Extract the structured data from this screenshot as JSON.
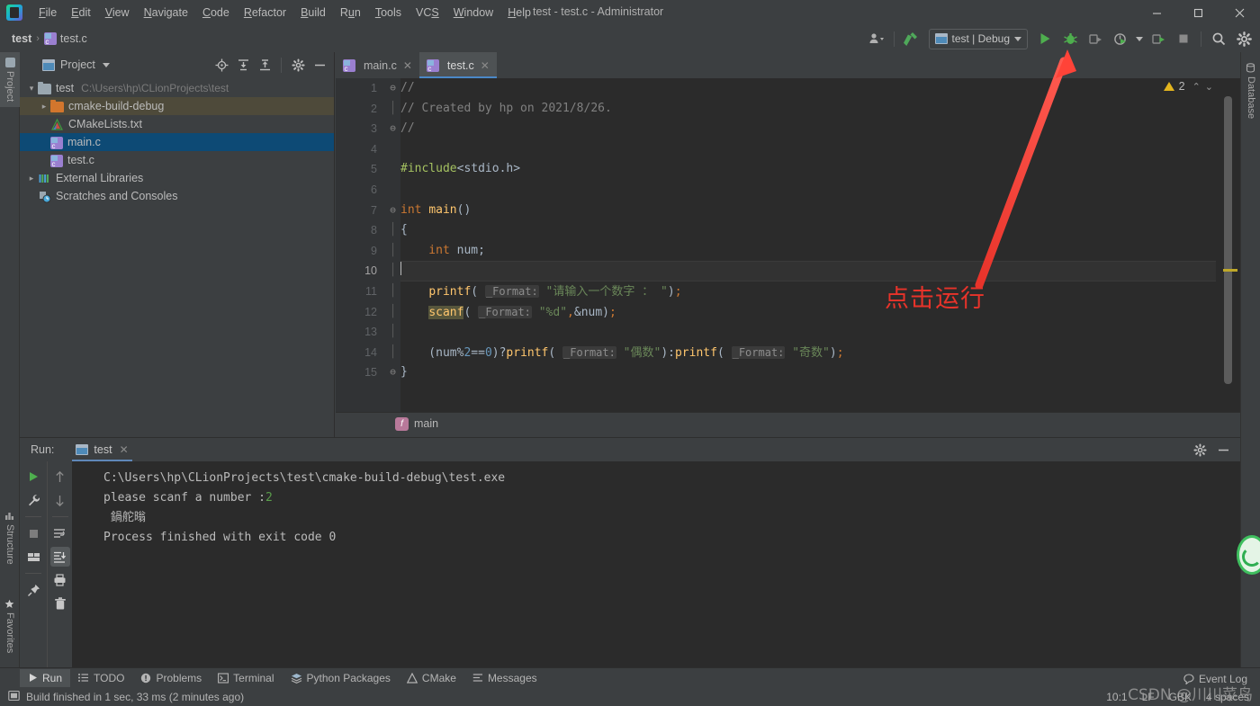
{
  "window": {
    "title": "test - test.c - Administrator",
    "minimize": "—",
    "maximize": "▢",
    "close": "✕"
  },
  "menu": [
    {
      "label": "File"
    },
    {
      "label": "Edit"
    },
    {
      "label": "View"
    },
    {
      "label": "Navigate"
    },
    {
      "label": "Code"
    },
    {
      "label": "Refactor"
    },
    {
      "label": "Build"
    },
    {
      "label": "Run"
    },
    {
      "label": "Tools"
    },
    {
      "label": "VCS"
    },
    {
      "label": "Window"
    },
    {
      "label": "Help"
    }
  ],
  "breadcrumb": {
    "project": "test",
    "separator": "›",
    "file": "test.c"
  },
  "toolbar": {
    "run_config": "test | Debug",
    "buttons": [
      "user-icon",
      "build-hammer-icon",
      "run-icon",
      "debug-icon",
      "run-with-coverage-icon",
      "profile-icon",
      "attach-icon",
      "stop-icon",
      "search-everywhere-icon",
      "settings-icon"
    ]
  },
  "left_strip": [
    {
      "label": "Project",
      "selected": true
    },
    {
      "label": "Structure",
      "selected": false
    },
    {
      "label": "Favorites",
      "selected": false
    }
  ],
  "right_strip": [
    {
      "label": "Database"
    }
  ],
  "project_panel": {
    "title": "Project",
    "header_buttons": [
      "locate-icon",
      "expand-all-icon",
      "collapse-all-icon",
      "settings-icon",
      "hide-icon"
    ],
    "tree": [
      {
        "label": "test",
        "path": "C:\\Users\\hp\\CLionProjects\\test",
        "icon": "folder-grey-icon",
        "arrow": "v",
        "indent": 0,
        "state": "none"
      },
      {
        "label": "cmake-build-debug",
        "path": "",
        "icon": "folder-orange-icon",
        "arrow": ">",
        "indent": 1,
        "state": "hl"
      },
      {
        "label": "CMakeLists.txt",
        "path": "",
        "icon": "cmake-icon",
        "arrow": "",
        "indent": 1,
        "state": "none"
      },
      {
        "label": "main.c",
        "path": "",
        "icon": "c-file-icon",
        "arrow": "",
        "indent": 1,
        "state": "sel"
      },
      {
        "label": "test.c",
        "path": "",
        "icon": "c-file-icon",
        "arrow": "",
        "indent": 1,
        "state": "none"
      },
      {
        "label": "External Libraries",
        "path": "",
        "icon": "libraries-icon",
        "arrow": ">",
        "indent": 0,
        "state": "none"
      },
      {
        "label": "Scratches and Consoles",
        "path": "",
        "icon": "scratches-icon",
        "arrow": "",
        "indent": 0,
        "state": "none"
      }
    ]
  },
  "editor": {
    "tabs": [
      {
        "label": "main.c",
        "active": false
      },
      {
        "label": "test.c",
        "active": true
      }
    ],
    "inspection_count": "2",
    "current_line": 10,
    "breadcrumb_function": "main",
    "lines": [
      {
        "n": "1",
        "fold": "⊖"
      },
      {
        "n": "2",
        "fold": ""
      },
      {
        "n": "3",
        "fold": "⊖"
      },
      {
        "n": "4",
        "fold": ""
      },
      {
        "n": "5",
        "fold": ""
      },
      {
        "n": "6",
        "fold": ""
      },
      {
        "n": "7",
        "fold": "⊖"
      },
      {
        "n": "8",
        "fold": ""
      },
      {
        "n": "9",
        "fold": ""
      },
      {
        "n": "10",
        "fold": ""
      },
      {
        "n": "11",
        "fold": ""
      },
      {
        "n": "12",
        "fold": ""
      },
      {
        "n": "13",
        "fold": ""
      },
      {
        "n": "14",
        "fold": ""
      },
      {
        "n": "15",
        "fold": "⊖"
      }
    ],
    "source_text": [
      "//",
      "// Created by hp on 2021/8/26.",
      "//",
      "",
      "#include<stdio.h>",
      "",
      "int main()",
      "{",
      "    int num;",
      "",
      "    printf( _Format: \"请输入一个数字 ： \");",
      "    scanf( _Format: \"%d\",&num);",
      "",
      "    (num%2==0)?printf( _Format: \"偶数\"):printf( _Format: \"奇数\");",
      "}"
    ]
  },
  "run_panel": {
    "label": "Run:",
    "tab": "test",
    "sidebar_buttons": [
      "rerun-icon",
      "settings-wrench-icon",
      "stop-icon",
      "layout-icon",
      "pin-icon"
    ],
    "sidebar2_buttons": [
      "up-icon",
      "down-icon",
      "soft-wrap-icon",
      "scroll-to-end-icon",
      "print-icon",
      "trash-icon"
    ],
    "header_buttons": [
      "settings-icon",
      "hide-icon"
    ],
    "console": [
      {
        "text": "C:\\Users\\hp\\CLionProjects\\test\\cmake-build-debug\\test.exe",
        "value": ""
      },
      {
        "text": "please scanf a number :",
        "value": "2"
      },
      {
        "text": " 鍋舵暡",
        "value": ""
      },
      {
        "text": "Process finished with exit code 0",
        "value": ""
      }
    ]
  },
  "tool_windows": [
    {
      "label": "Run",
      "icon": "run-icon",
      "active": true
    },
    {
      "label": "TODO",
      "icon": "todo-icon",
      "active": false
    },
    {
      "label": "Problems",
      "icon": "problems-icon",
      "active": false
    },
    {
      "label": "Terminal",
      "icon": "terminal-icon",
      "active": false
    },
    {
      "label": "Python Packages",
      "icon": "python-packages-icon",
      "active": false
    },
    {
      "label": "CMake",
      "icon": "cmake-icon",
      "active": false
    },
    {
      "label": "Messages",
      "icon": "messages-icon",
      "active": false
    }
  ],
  "status_bar": {
    "message": "Build finished in 1 sec, 33 ms (2 minutes ago)",
    "caret": "10:1",
    "line_ending": "LF",
    "encoding": "GBK",
    "indent": "4 spaces",
    "event_log": "Event Log"
  },
  "annotations": {
    "arrow_label": "点击运行",
    "arrow_color": "#e8332a",
    "watermark": "CSDN @川川菜鸟"
  },
  "colors": {
    "background": "#3c3f41",
    "editor_background": "#2b2b2b",
    "selection": "#0d4a75",
    "accent_blue": "#4a88c7",
    "run_green": "#4eae4e",
    "keyword": "#cc7832",
    "string": "#6a8759",
    "function": "#ffc66d",
    "comment": "#808080",
    "number": "#6897bb"
  }
}
